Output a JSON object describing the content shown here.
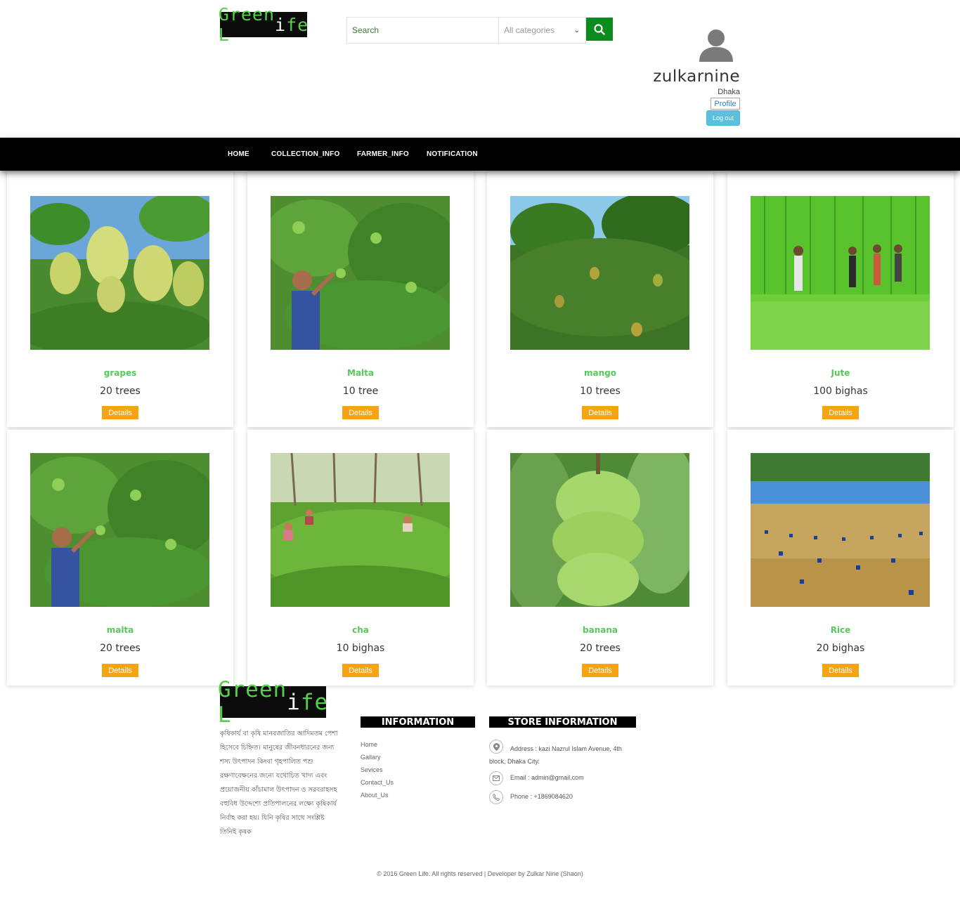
{
  "header": {
    "logo_green": "Green L",
    "logo_white": "i",
    "logo_green2": "fe",
    "search_placeholder": "Search",
    "category_selected": "All categories",
    "user_name": "zulkarnine",
    "user_city": "Dhaka",
    "profile_label": "Profile",
    "logout_label": "Log out"
  },
  "nav": [
    "HOME",
    "COLLECTION_INFO",
    "FARMER_INFO",
    "NOTIFICATION"
  ],
  "products": [
    {
      "name": "grapes",
      "qty": "20 trees",
      "details": "Details",
      "image": "grapes-vine"
    },
    {
      "name": "Malta",
      "qty": "10 tree",
      "details": "Details",
      "image": "malta-tree"
    },
    {
      "name": "mango",
      "qty": "10 trees",
      "details": "Details",
      "image": "mango-tree"
    },
    {
      "name": "Jute",
      "qty": "100 bighas",
      "details": "Details",
      "image": "jute-field"
    },
    {
      "name": "malta",
      "qty": "20 trees",
      "details": "Details",
      "image": "malta-tree"
    },
    {
      "name": "cha",
      "qty": "10 bighas",
      "details": "Details",
      "image": "tea-garden"
    },
    {
      "name": "banana",
      "qty": "20 trees",
      "details": "Details",
      "image": "banana-bunch"
    },
    {
      "name": "Rice",
      "qty": "20 bighas",
      "details": "Details",
      "image": "rice-field"
    }
  ],
  "footer": {
    "description": "কৃষিকার্য বা কৃষি মানবজাতির আদিমতম পেশা হিসেবে চিহ্নিত। মানুষের জীবনধারনের জন্য শস্য উৎপাদন কিংবা গৃহপালিত পশু রক্ষণাবেক্ষনের জন্যে যথোচিত খাদ্য এবং প্রয়োজনীয় কাঁচামাল উৎপাদন ও সরবরাহসহ বহুবিধ উদ্দেশ্যে প্রতিপালনের লক্ষ্যে কৃষিকার্য নির্বাহ করা হয়। যিনি কৃষির সাথে সংশ্লিষ্ট তিনিই কৃষক",
    "information_title": "INFORMATION",
    "links": [
      "Home",
      "Gallary",
      "Sevices",
      "Contact_Us",
      "About_Us"
    ],
    "store_title": "STORE INFORMATION",
    "address": "Address : kazi Nazrul Islam Avenue, 4th block, Dhaka City.",
    "email": "Email : admin@gmail.com",
    "phone": "Phone : +1869084620",
    "copyright": "© 2016 Green Life. All rights reserved | Developer by Zulkar Nine (Shaon)"
  },
  "colors": {
    "accent_green": "#0b8a1e",
    "name_green": "#57c95a",
    "details_orange": "#f7a414",
    "logout_blue": "#5bc0de"
  }
}
